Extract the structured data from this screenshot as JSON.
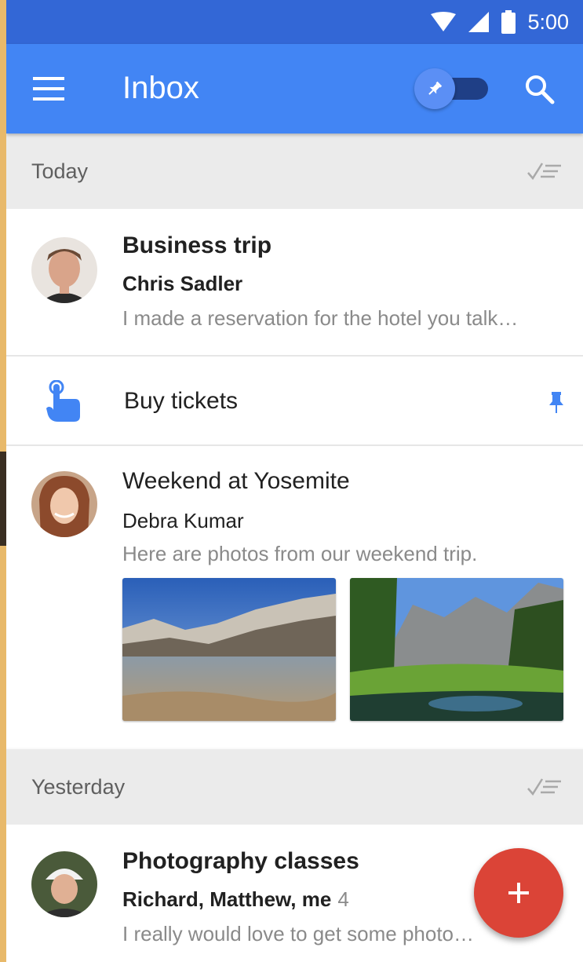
{
  "status": {
    "time": "5:00"
  },
  "appbar": {
    "title": "Inbox"
  },
  "sections": [
    {
      "title": "Today"
    },
    {
      "title": "Yesterday"
    }
  ],
  "items": [
    {
      "subject": "Business trip",
      "sender": "Chris Sadler",
      "snippet": "I made a reservation for the hotel you talk…"
    },
    {
      "reminder": "Buy tickets"
    },
    {
      "subject": "Weekend at Yosemite",
      "sender": "Debra Kumar",
      "snippet": "Here are photos from our weekend trip."
    },
    {
      "subject": "Photography classes",
      "sender": "Richard, Matthew, me",
      "count": "4",
      "snippet": "I really would love to get some photo…"
    }
  ],
  "colors": {
    "status_bar": "#3367d6",
    "app_bar": "#4285f4",
    "fab": "#db4437",
    "reminder_icon": "#4285f4"
  },
  "icons": [
    "wifi-icon",
    "signal-icon",
    "battery-icon",
    "menu-icon",
    "pin-icon",
    "search-icon",
    "sweep-icon",
    "reminder-hand-icon",
    "add-icon"
  ]
}
